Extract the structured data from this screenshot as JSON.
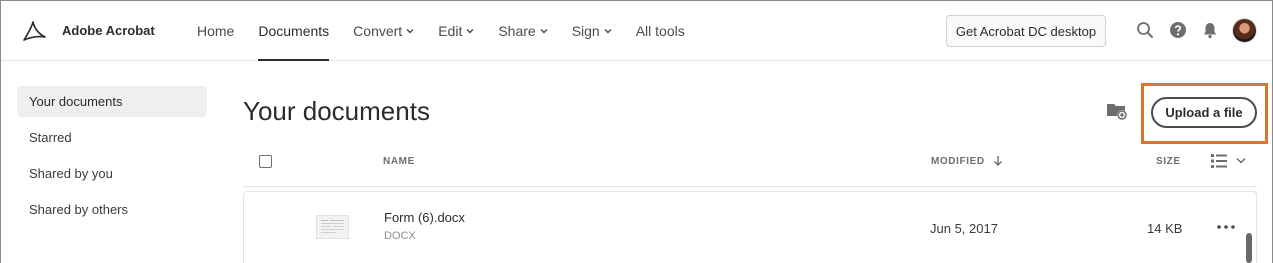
{
  "app": {
    "brand": "Adobe Acrobat"
  },
  "nav": [
    {
      "label": "Home",
      "dropdown": false,
      "active": false
    },
    {
      "label": "Documents",
      "dropdown": false,
      "active": true
    },
    {
      "label": "Convert",
      "dropdown": true,
      "active": false
    },
    {
      "label": "Edit",
      "dropdown": true,
      "active": false
    },
    {
      "label": "Share",
      "dropdown": true,
      "active": false
    },
    {
      "label": "Sign",
      "dropdown": true,
      "active": false
    },
    {
      "label": "All tools",
      "dropdown": false,
      "active": false
    }
  ],
  "toolbar": {
    "desktop_button": "Get Acrobat DC desktop",
    "icons": [
      "search-icon",
      "help-icon",
      "bell-icon",
      "avatar"
    ]
  },
  "sidebar": {
    "items": [
      {
        "label": "Your documents",
        "active": true
      },
      {
        "label": "Starred",
        "active": false
      },
      {
        "label": "Shared by you",
        "active": false
      },
      {
        "label": "Shared by others",
        "active": false
      }
    ]
  },
  "main": {
    "title": "Your documents",
    "upload_label": "Upload a file",
    "columns": {
      "name": "NAME",
      "modified": "MODIFIED",
      "size": "SIZE"
    },
    "files": [
      {
        "name": "Form (6).docx",
        "type": "DOCX",
        "modified": "Jun 5, 2017",
        "size": "14 KB"
      }
    ]
  },
  "colors": {
    "highlight": "#e0742a",
    "text": "#2c2c2c"
  }
}
